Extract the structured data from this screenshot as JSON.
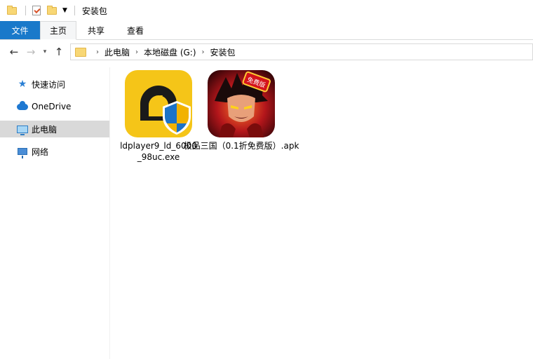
{
  "window": {
    "title": "安装包"
  },
  "ribbon": {
    "tabs": [
      {
        "label": "文件"
      },
      {
        "label": "主页"
      },
      {
        "label": "共享"
      },
      {
        "label": "查看"
      }
    ]
  },
  "address": {
    "crumbs": [
      "此电脑",
      "本地磁盘 (G:)",
      "安装包"
    ]
  },
  "sidebar": {
    "items": [
      {
        "label": "快速访问",
        "icon": "star-icon"
      },
      {
        "label": "OneDrive",
        "icon": "cloud-icon"
      },
      {
        "label": "此电脑",
        "icon": "computer-icon"
      },
      {
        "label": "网络",
        "icon": "network-icon"
      }
    ]
  },
  "files": [
    {
      "name": "ldplayer9_ld_6000_98uc.exe",
      "icon": "ldplayer-icon"
    },
    {
      "name": "极品三国（0.1折免费版）.apk",
      "icon": "game-icon",
      "badge": "免费版"
    }
  ],
  "colors": {
    "accent": "#1979ca",
    "selected": "#d9d9d9",
    "ldplayer_bg": "#f5c518"
  }
}
